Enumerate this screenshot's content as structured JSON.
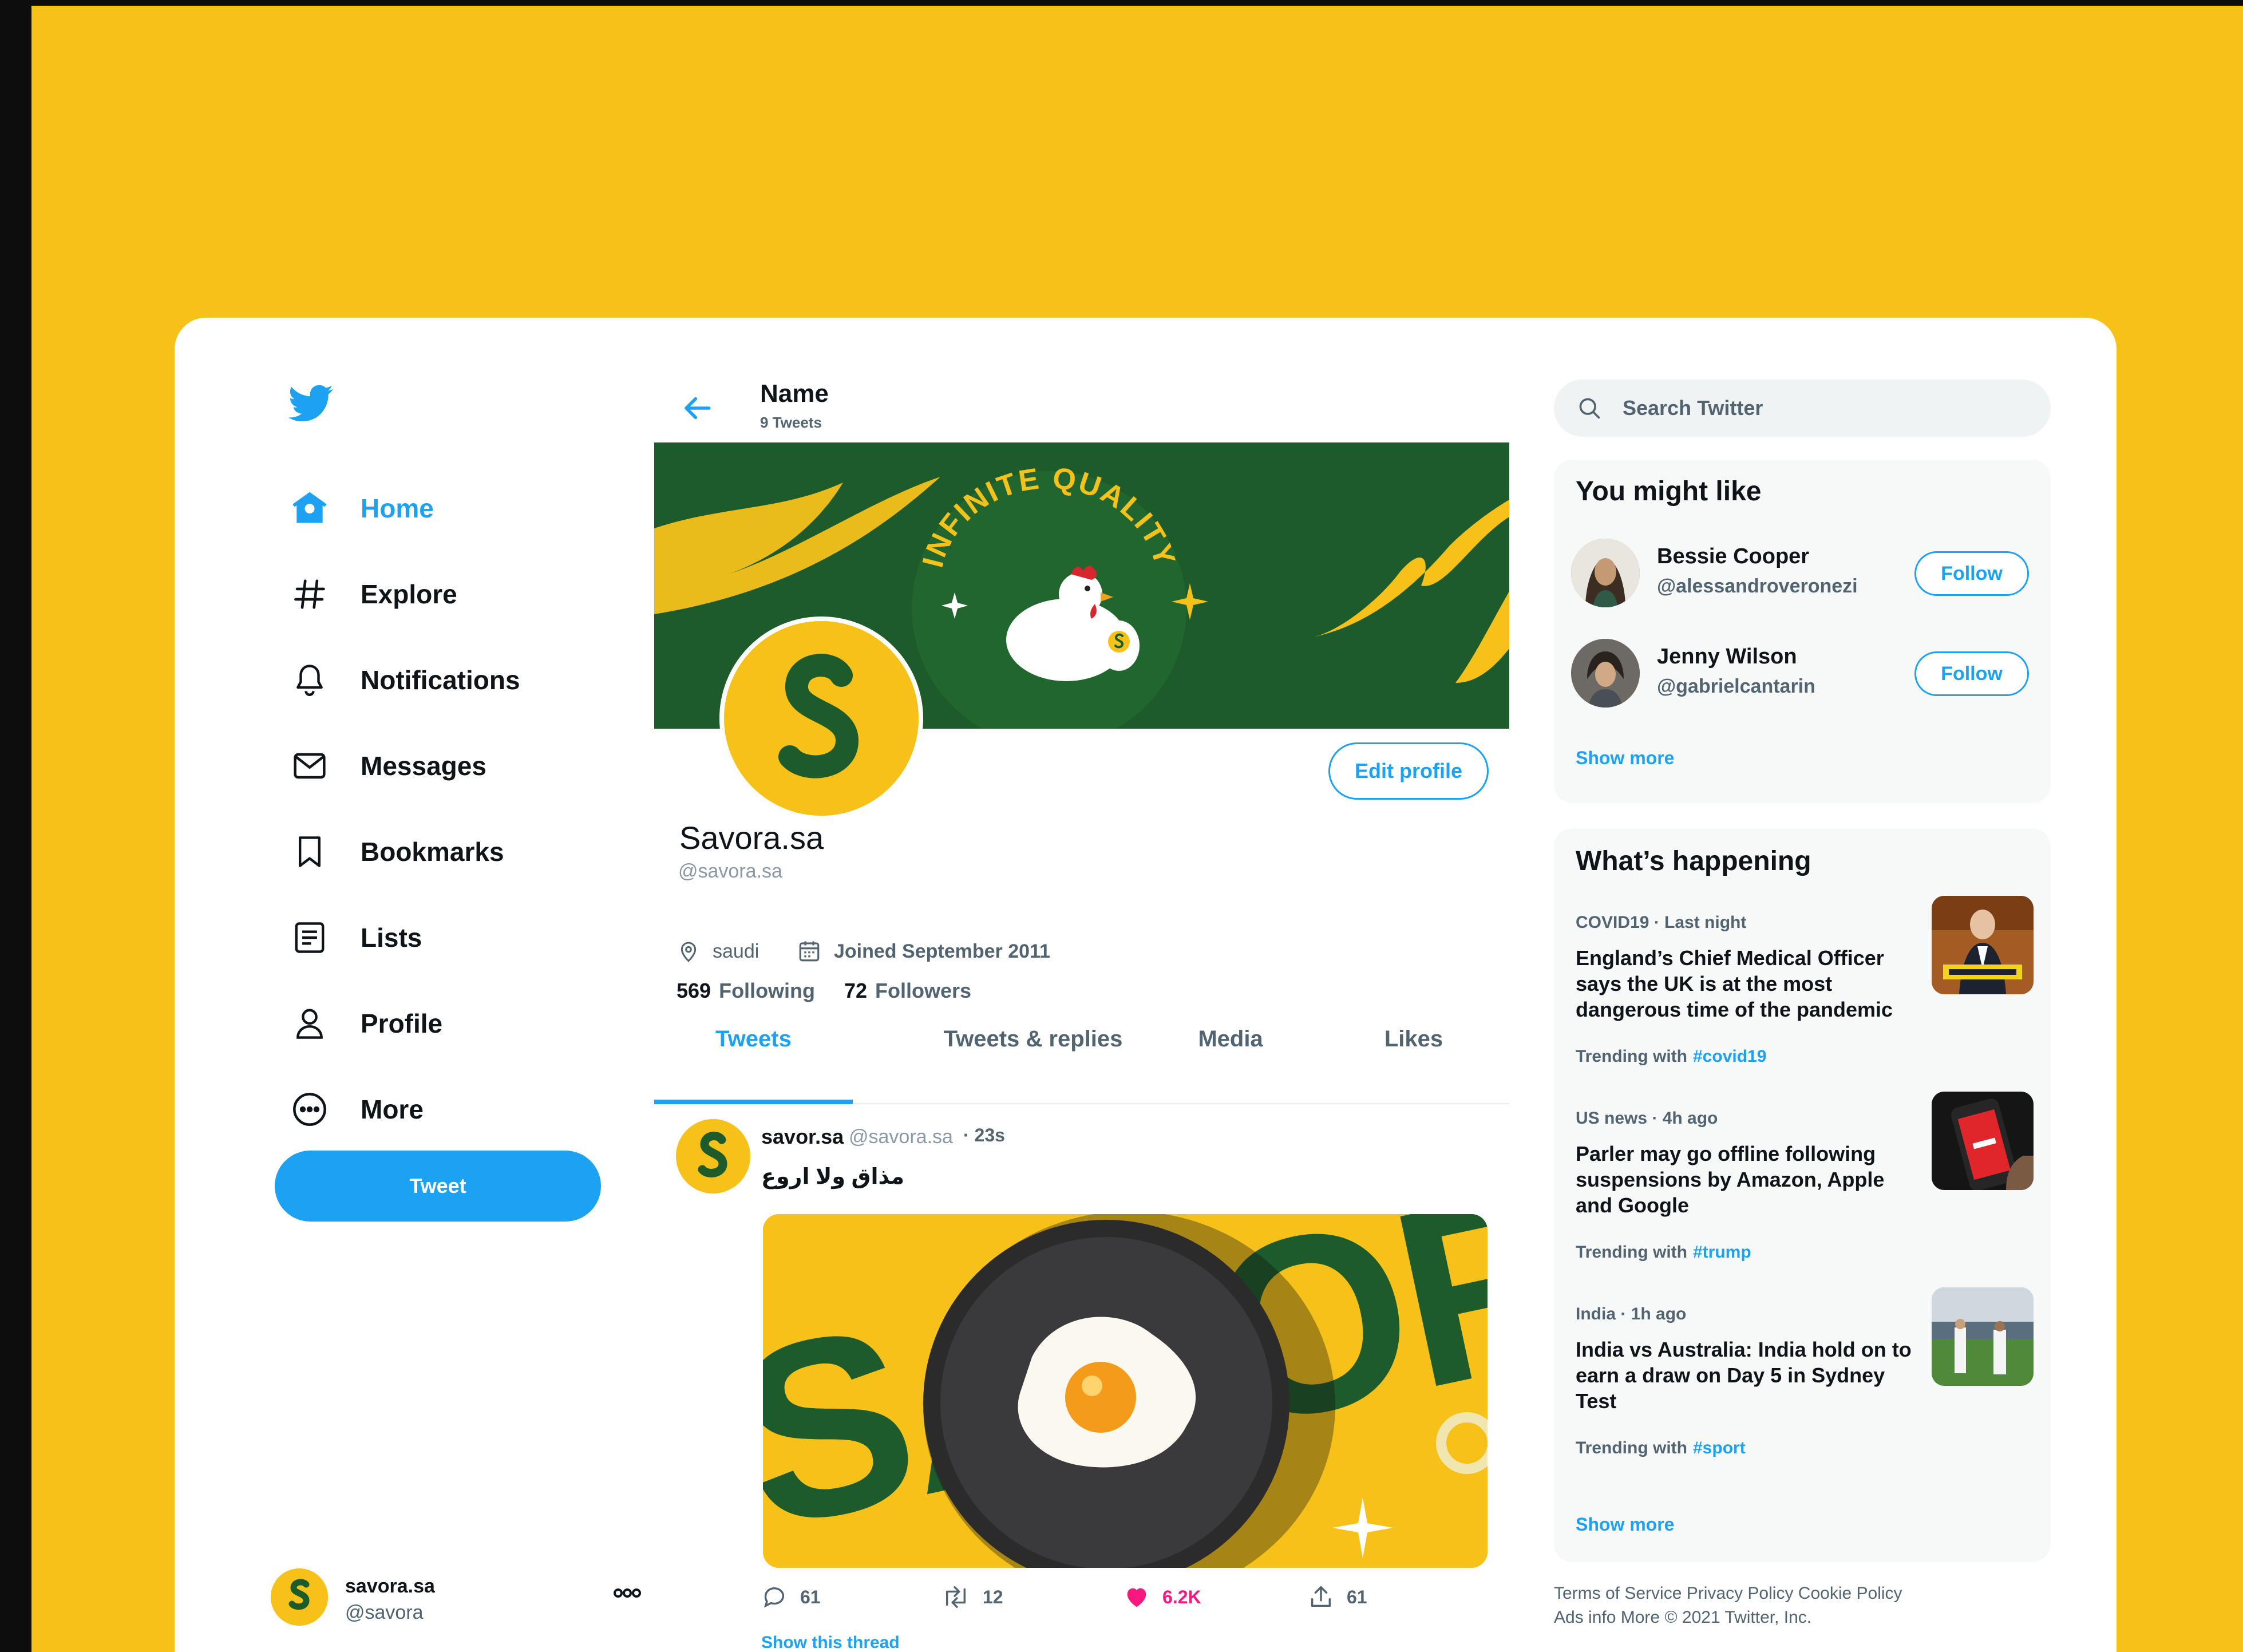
{
  "colors": {
    "accent": "#1DA1F2",
    "brand_yellow": "#F6C21A",
    "brand_green": "#1E5B2A",
    "like": "#F91880"
  },
  "sidebar": {
    "logo": "twitter-bird-icon",
    "items": [
      {
        "label": "Home",
        "icon": "home-icon",
        "active": true
      },
      {
        "label": "Explore",
        "icon": "hashtag-icon"
      },
      {
        "label": "Notifications",
        "icon": "bell-icon"
      },
      {
        "label": "Messages",
        "icon": "mail-icon"
      },
      {
        "label": "Bookmarks",
        "icon": "bookmark-icon"
      },
      {
        "label": "Lists",
        "icon": "list-icon"
      },
      {
        "label": "Profile",
        "icon": "person-icon"
      },
      {
        "label": "More",
        "icon": "more-circle-icon"
      }
    ],
    "tweet_button": "Tweet",
    "account": {
      "name": "savora.sa",
      "handle": "@savora"
    }
  },
  "header": {
    "name": "Name",
    "tweet_count": "9 Tweets"
  },
  "banner": {
    "text": "INFINITE QUALITY"
  },
  "profile": {
    "display_name": "Savora.sa",
    "handle": "@savora.sa",
    "edit_button": "Edit profile",
    "location": "saudi",
    "joined": "Joined September 2011",
    "following_count": "569",
    "following_label": "Following",
    "followers_count": "72",
    "followers_label": "Followers"
  },
  "tabs": [
    "Tweets",
    "Tweets & replies",
    "Media",
    "Likes"
  ],
  "active_tab": "Tweets",
  "tweet": {
    "name": "savor.sa",
    "handle": "@savora.sa",
    "time": "· 23s",
    "text": "مذاق ولا اروع",
    "media_text": "SAVORA",
    "reply_count": "61",
    "retweet_count": "12",
    "like_count": "6.2K",
    "share_count": "61",
    "show_thread": "Show this thread"
  },
  "search": {
    "placeholder": "Search Twitter"
  },
  "you_might_like": {
    "title": "You might like",
    "users": [
      {
        "name": "Bessie Cooper",
        "handle": "@alessandroveronezi",
        "follow": "Follow"
      },
      {
        "name": "Jenny Wilson",
        "handle": "@gabrielcantarin",
        "follow": "Follow"
      }
    ],
    "show_more": "Show more"
  },
  "whats_happening": {
    "title": "What’s happening",
    "trends": [
      {
        "meta": "COVID19 · Last night",
        "headline": "England’s Chief Medical Officer says the UK is at the most dangerous time of the pandemic",
        "trending_label": "Trending with",
        "tag": "#covid19"
      },
      {
        "meta": "US news · 4h ago",
        "headline": "Parler may go offline following suspensions by Amazon, Apple and Google",
        "trending_label": "Trending with",
        "tag": "#trump"
      },
      {
        "meta": "India · 1h ago",
        "headline": "India vs Australia: India hold on to earn a draw on Day 5 in Sydney Test",
        "trending_label": "Trending with",
        "tag": "#sport"
      }
    ],
    "show_more": "Show more"
  },
  "footer": {
    "terms": "Terms of Service",
    "privacy": "Privacy Policy",
    "cookie": "Cookie Policy",
    "ads": "Ads info",
    "more": "More",
    "copyright": "© 2021 Twitter, Inc."
  }
}
